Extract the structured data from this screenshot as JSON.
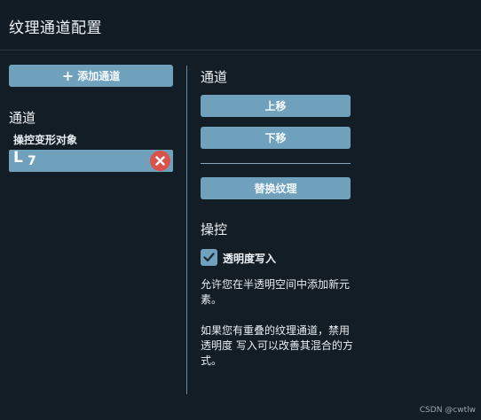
{
  "header": {
    "title": "纹理通道配置"
  },
  "left": {
    "add_channel_label": "添加通道",
    "channels_heading": "通道",
    "target_label": "操控变形对象",
    "channel_item": {
      "prefix": "L",
      "number": "7"
    }
  },
  "right": {
    "channel_heading": "通道",
    "move_up_label": "上移",
    "move_down_label": "下移",
    "replace_texture_label": "替换纹理",
    "control_heading": "操控",
    "transparency_write": {
      "label": "透明度写入",
      "checked": true
    },
    "desc1": "允许您在半透明空间中添加新元素。",
    "desc2": "如果您有重叠的纹理通道，禁用透明度 写入可以改善其混合的方式。"
  },
  "watermark": "CSDN @cwtlw",
  "colors": {
    "accent": "#6fa0bc",
    "background": "#131d26",
    "remove": "#d9534a"
  },
  "icons": {
    "add": "plus-icon",
    "remove": "close-icon",
    "check": "checkmark-icon"
  }
}
